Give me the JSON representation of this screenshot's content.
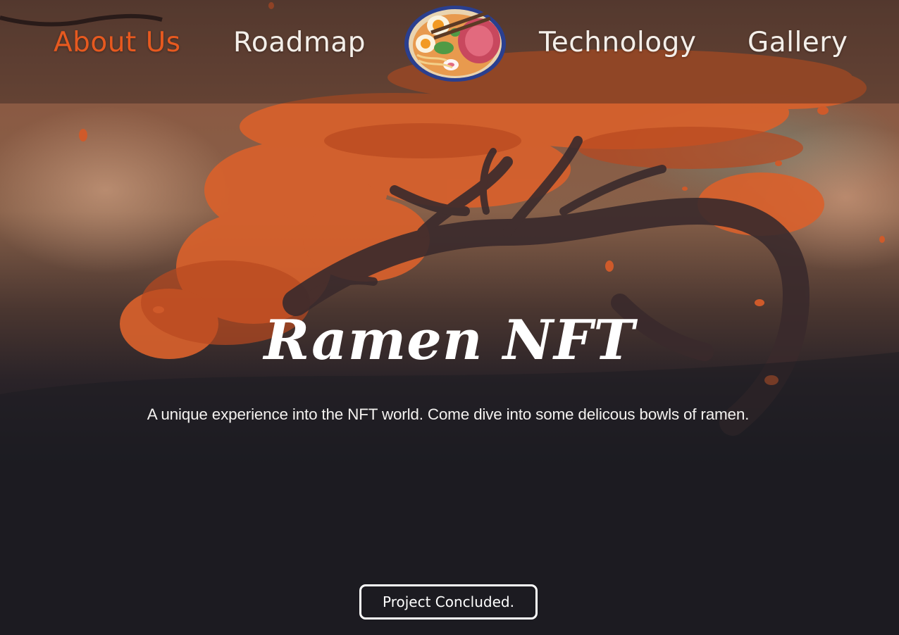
{
  "nav": {
    "items": [
      {
        "label": "About Us",
        "active": true
      },
      {
        "label": "Roadmap",
        "active": false
      },
      {
        "label": "Technology",
        "active": false
      },
      {
        "label": "Gallery",
        "active": false
      }
    ],
    "logo_icon": "ramen-bowl-icon"
  },
  "hero": {
    "title": "Ramen NFT",
    "subtitle": "A unique experience into the NFT world. Come dive into some delicous bowls of ramen.",
    "status_button": "Project Concluded."
  },
  "colors": {
    "accent": "#e7591f",
    "background": "#1c1b21",
    "text": "#ffffff"
  }
}
